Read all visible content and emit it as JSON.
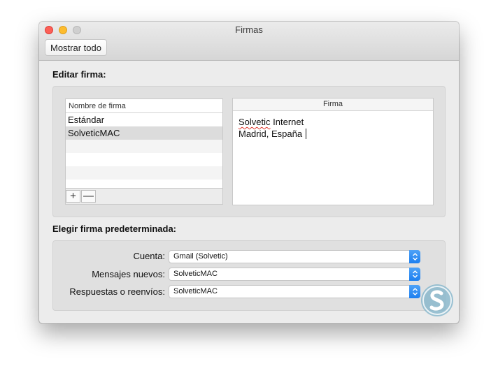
{
  "window": {
    "title": "Firmas",
    "toolbar_button": "Mostrar todo"
  },
  "edit_section": {
    "label": "Editar firma:",
    "list_header": "Nombre de firma",
    "items": [
      {
        "label": "Estándar",
        "selected": false
      },
      {
        "label": "SolveticMAC",
        "selected": true
      }
    ],
    "add_button": "+",
    "remove_button": "—",
    "signature_header": "Firma",
    "signature_lines": [
      "Solvetic Internet",
      "Madrid, España"
    ],
    "signature_spell_word": "Solvetic",
    "signature_rest_line1": " Internet"
  },
  "default_section": {
    "label": "Elegir firma predeterminada:",
    "rows": [
      {
        "label": "Cuenta:",
        "value": "Gmail (Solvetic)"
      },
      {
        "label": "Mensajes nuevos:",
        "value": "SolveticMAC"
      },
      {
        "label": "Respuestas o reenvíos:",
        "value": "SolveticMAC"
      }
    ]
  },
  "colors": {
    "accent": "#1c7ff0",
    "close": "#fc5f57",
    "minimize": "#fdbc2e",
    "zoom": "#cfcfcf",
    "logo": "#7fb3c9"
  },
  "icons": [
    "close-traffic-light",
    "minimize-traffic-light",
    "zoom-traffic-light",
    "stepper-icon",
    "solvetic-logo"
  ]
}
